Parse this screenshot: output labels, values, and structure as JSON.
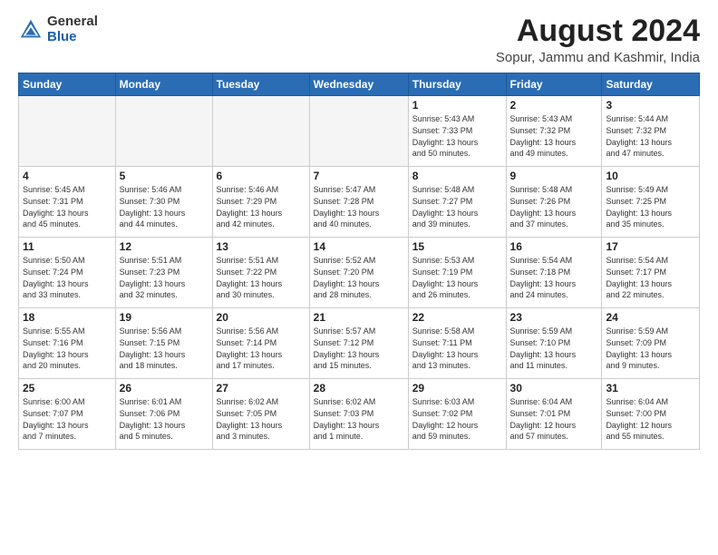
{
  "header": {
    "logo_general": "General",
    "logo_blue": "Blue",
    "month_title": "August 2024",
    "location": "Sopur, Jammu and Kashmir, India"
  },
  "days_of_week": [
    "Sunday",
    "Monday",
    "Tuesday",
    "Wednesday",
    "Thursday",
    "Friday",
    "Saturday"
  ],
  "weeks": [
    [
      {
        "day": "",
        "info": ""
      },
      {
        "day": "",
        "info": ""
      },
      {
        "day": "",
        "info": ""
      },
      {
        "day": "",
        "info": ""
      },
      {
        "day": "1",
        "info": "Sunrise: 5:43 AM\nSunset: 7:33 PM\nDaylight: 13 hours\nand 50 minutes."
      },
      {
        "day": "2",
        "info": "Sunrise: 5:43 AM\nSunset: 7:32 PM\nDaylight: 13 hours\nand 49 minutes."
      },
      {
        "day": "3",
        "info": "Sunrise: 5:44 AM\nSunset: 7:32 PM\nDaylight: 13 hours\nand 47 minutes."
      }
    ],
    [
      {
        "day": "4",
        "info": "Sunrise: 5:45 AM\nSunset: 7:31 PM\nDaylight: 13 hours\nand 45 minutes."
      },
      {
        "day": "5",
        "info": "Sunrise: 5:46 AM\nSunset: 7:30 PM\nDaylight: 13 hours\nand 44 minutes."
      },
      {
        "day": "6",
        "info": "Sunrise: 5:46 AM\nSunset: 7:29 PM\nDaylight: 13 hours\nand 42 minutes."
      },
      {
        "day": "7",
        "info": "Sunrise: 5:47 AM\nSunset: 7:28 PM\nDaylight: 13 hours\nand 40 minutes."
      },
      {
        "day": "8",
        "info": "Sunrise: 5:48 AM\nSunset: 7:27 PM\nDaylight: 13 hours\nand 39 minutes."
      },
      {
        "day": "9",
        "info": "Sunrise: 5:48 AM\nSunset: 7:26 PM\nDaylight: 13 hours\nand 37 minutes."
      },
      {
        "day": "10",
        "info": "Sunrise: 5:49 AM\nSunset: 7:25 PM\nDaylight: 13 hours\nand 35 minutes."
      }
    ],
    [
      {
        "day": "11",
        "info": "Sunrise: 5:50 AM\nSunset: 7:24 PM\nDaylight: 13 hours\nand 33 minutes."
      },
      {
        "day": "12",
        "info": "Sunrise: 5:51 AM\nSunset: 7:23 PM\nDaylight: 13 hours\nand 32 minutes."
      },
      {
        "day": "13",
        "info": "Sunrise: 5:51 AM\nSunset: 7:22 PM\nDaylight: 13 hours\nand 30 minutes."
      },
      {
        "day": "14",
        "info": "Sunrise: 5:52 AM\nSunset: 7:20 PM\nDaylight: 13 hours\nand 28 minutes."
      },
      {
        "day": "15",
        "info": "Sunrise: 5:53 AM\nSunset: 7:19 PM\nDaylight: 13 hours\nand 26 minutes."
      },
      {
        "day": "16",
        "info": "Sunrise: 5:54 AM\nSunset: 7:18 PM\nDaylight: 13 hours\nand 24 minutes."
      },
      {
        "day": "17",
        "info": "Sunrise: 5:54 AM\nSunset: 7:17 PM\nDaylight: 13 hours\nand 22 minutes."
      }
    ],
    [
      {
        "day": "18",
        "info": "Sunrise: 5:55 AM\nSunset: 7:16 PM\nDaylight: 13 hours\nand 20 minutes."
      },
      {
        "day": "19",
        "info": "Sunrise: 5:56 AM\nSunset: 7:15 PM\nDaylight: 13 hours\nand 18 minutes."
      },
      {
        "day": "20",
        "info": "Sunrise: 5:56 AM\nSunset: 7:14 PM\nDaylight: 13 hours\nand 17 minutes."
      },
      {
        "day": "21",
        "info": "Sunrise: 5:57 AM\nSunset: 7:12 PM\nDaylight: 13 hours\nand 15 minutes."
      },
      {
        "day": "22",
        "info": "Sunrise: 5:58 AM\nSunset: 7:11 PM\nDaylight: 13 hours\nand 13 minutes."
      },
      {
        "day": "23",
        "info": "Sunrise: 5:59 AM\nSunset: 7:10 PM\nDaylight: 13 hours\nand 11 minutes."
      },
      {
        "day": "24",
        "info": "Sunrise: 5:59 AM\nSunset: 7:09 PM\nDaylight: 13 hours\nand 9 minutes."
      }
    ],
    [
      {
        "day": "25",
        "info": "Sunrise: 6:00 AM\nSunset: 7:07 PM\nDaylight: 13 hours\nand 7 minutes."
      },
      {
        "day": "26",
        "info": "Sunrise: 6:01 AM\nSunset: 7:06 PM\nDaylight: 13 hours\nand 5 minutes."
      },
      {
        "day": "27",
        "info": "Sunrise: 6:02 AM\nSunset: 7:05 PM\nDaylight: 13 hours\nand 3 minutes."
      },
      {
        "day": "28",
        "info": "Sunrise: 6:02 AM\nSunset: 7:03 PM\nDaylight: 13 hours\nand 1 minute."
      },
      {
        "day": "29",
        "info": "Sunrise: 6:03 AM\nSunset: 7:02 PM\nDaylight: 12 hours\nand 59 minutes."
      },
      {
        "day": "30",
        "info": "Sunrise: 6:04 AM\nSunset: 7:01 PM\nDaylight: 12 hours\nand 57 minutes."
      },
      {
        "day": "31",
        "info": "Sunrise: 6:04 AM\nSunset: 7:00 PM\nDaylight: 12 hours\nand 55 minutes."
      }
    ]
  ]
}
